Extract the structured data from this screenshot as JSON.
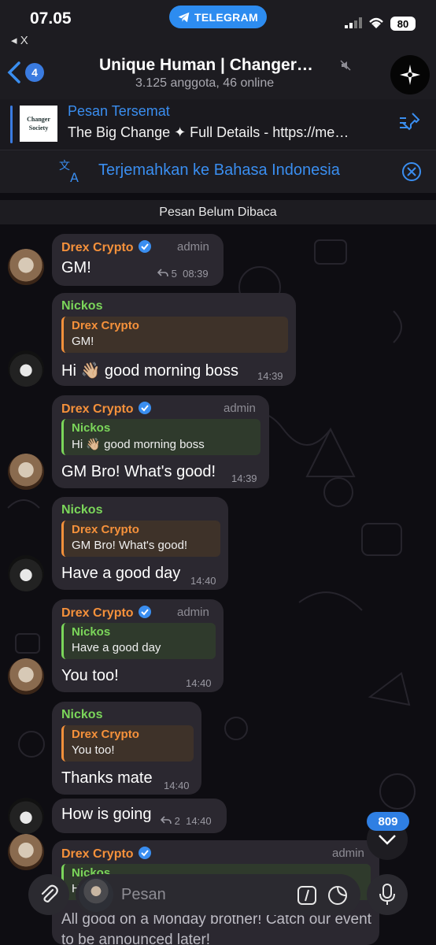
{
  "status": {
    "time": "07.05",
    "back_app": "◂ X",
    "pill_label": "TELEGRAM",
    "battery": "80"
  },
  "header": {
    "back_badge": "4",
    "title": "Unique Human | Changer…",
    "subtitle": "3.125 anggota, 46 online"
  },
  "pinned": {
    "title": "Pesan Tersemat",
    "text": "The Big Change ✦ Full Details - https://me…",
    "thumb_text": "Changer Society"
  },
  "translate": {
    "text": "Terjemahkan ke Bahasa Indonesia"
  },
  "unread_label": "Pesan Belum Dibaca",
  "messages": [
    {
      "sender": "Drex Crypto",
      "role": "admin",
      "text": "GM!",
      "replies": "5",
      "time": "08:39"
    },
    {
      "sender": "Nickos",
      "reply_name": "Drex Crypto",
      "reply_text": "GM!",
      "text": "Hi 👋🏼 good morning boss",
      "time": "14:39"
    },
    {
      "sender": "Drex Crypto",
      "role": "admin",
      "reply_name": "Nickos",
      "reply_text": "Hi 👋🏼 good morning boss",
      "text": "GM Bro! What's good!",
      "time": "14:39"
    },
    {
      "sender": "Nickos",
      "reply_name": "Drex Crypto",
      "reply_text": "GM Bro! What's good!",
      "text": "Have a good day",
      "time": "14:40"
    },
    {
      "sender": "Drex Crypto",
      "role": "admin",
      "reply_name": "Nickos",
      "reply_text": "Have a good day",
      "text": "You too!",
      "time": "14:40"
    },
    {
      "sender": "Nickos",
      "reply_name": "Drex Crypto",
      "reply_text": "You too!",
      "text": "Thanks mate",
      "time": "14:40"
    },
    {
      "text": "How is going",
      "replies": "2",
      "time": "14:40"
    },
    {
      "sender": "Drex Crypto",
      "role": "admin",
      "reply_name": "Nickos",
      "reply_text": "H",
      "text": "All good on a Monday brother! Catch our event to be announced later!"
    }
  ],
  "unread_count": "809",
  "input": {
    "placeholder": "Pesan"
  },
  "colors": {
    "accent": "#3a8ef0",
    "drex": "#f5913b",
    "nickos": "#7bd65a",
    "bubble": "#2b2830"
  }
}
